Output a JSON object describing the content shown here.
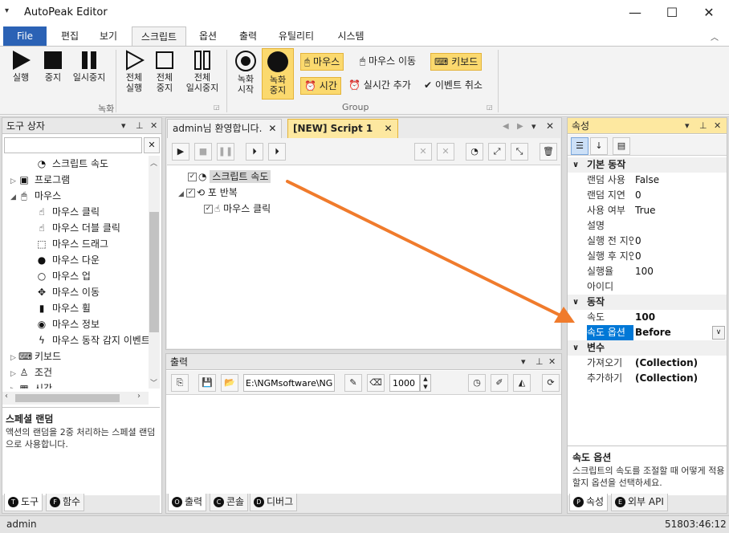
{
  "window": {
    "title": "AutoPeak Editor",
    "menu_glyph": "▾",
    "minimize": "—",
    "maximize": "☐",
    "close": "✕"
  },
  "ribbon_tabs": {
    "file": "File",
    "tabs": [
      "편집",
      "보기",
      "스크립트",
      "옵션",
      "출력",
      "유틸리티",
      "시스템"
    ],
    "active": "스크립트"
  },
  "ribbon": {
    "run": "실행",
    "stop": "중지",
    "pause": "일시중지",
    "run_all_1": "전체",
    "run_all_2": "실행",
    "stop_all_1": "전체",
    "stop_all_2": "중지",
    "pause_all_1": "전체",
    "pause_all_2": "일시중지",
    "rec_start_1": "녹화",
    "rec_start_2": "시작",
    "rec_stop_1": "녹화",
    "rec_stop_2": "중지",
    "group_record": "녹화",
    "group_group": "Group",
    "mouse": "마우스",
    "mouse_move": "마우스 이동",
    "keyboard": "키보드",
    "time": "시간",
    "realtime_add": "실시간 추가",
    "event_cancel": "이벤트 취소"
  },
  "toolbox": {
    "title": "도구 상자",
    "search_value": "",
    "items": [
      {
        "label": "스크립트 속도",
        "icon": "gauge-icon"
      },
      {
        "label": "프로그램",
        "icon": "program-icon"
      },
      {
        "label": "마우스",
        "icon": "mouse-icon"
      },
      {
        "label": "마우스 클릭",
        "icon": "mouse-click-icon"
      },
      {
        "label": "마우스 더블 클릭",
        "icon": "mouse-double-click-icon"
      },
      {
        "label": "마우스 드래그",
        "icon": "mouse-drag-icon"
      },
      {
        "label": "마우스 다운",
        "icon": "mouse-down-icon"
      },
      {
        "label": "마우스 업",
        "icon": "mouse-up-icon"
      },
      {
        "label": "마우스 이동",
        "icon": "mouse-move-icon"
      },
      {
        "label": "마우스 휠",
        "icon": "mouse-wheel-icon"
      },
      {
        "label": "마우스 정보",
        "icon": "mouse-info-icon"
      },
      {
        "label": "마우스 동작 감지 이벤트",
        "icon": "lightning-icon"
      },
      {
        "label": "키보드",
        "icon": "keyboard-icon"
      },
      {
        "label": "조건",
        "icon": "condition-icon"
      },
      {
        "label": "시간",
        "icon": "calendar-icon"
      }
    ],
    "desc_title": "스페셜 랜덤",
    "desc_text": "액션의 랜덤을 2중 처리하는 스페셜 랜덤으로 사용합니다.",
    "tab_tools": "도구",
    "tab_functions": "함수"
  },
  "editor": {
    "tab1": "admin님 환영합니다.",
    "tab2": "[NEW] Script 1",
    "tree": [
      {
        "label": "스크립트 속도"
      },
      {
        "label": "포 반복"
      },
      {
        "label": "마우스 클릭"
      }
    ]
  },
  "output": {
    "title": "출력",
    "path_value": "E:\\NGMsoftware\\NG",
    "number_value": "1000",
    "tab_output": "출력",
    "tab_console": "콘솔",
    "tab_debug": "디버그"
  },
  "properties": {
    "title": "속성",
    "categories": [
      {
        "name": "기본 동작",
        "rows": [
          {
            "name": "랜덤 사용",
            "value": "False"
          },
          {
            "name": "랜덤 지연",
            "value": "0"
          },
          {
            "name": "사용 여부",
            "value": "True"
          },
          {
            "name": "설명",
            "value": ""
          },
          {
            "name": "실행 전 지연",
            "value": "0"
          },
          {
            "name": "실행 후 지연",
            "value": "0"
          },
          {
            "name": "실행율",
            "value": "100"
          },
          {
            "name": "아이디",
            "value": ""
          }
        ]
      },
      {
        "name": "동작",
        "rows": [
          {
            "name": "속도",
            "value": "100"
          },
          {
            "name": "속도 옵션",
            "value": "Before"
          }
        ]
      },
      {
        "name": "변수",
        "rows": [
          {
            "name": "가져오기",
            "value": "(Collection)"
          },
          {
            "name": "추가하기",
            "value": "(Collection)"
          }
        ]
      }
    ],
    "desc_title": "속도 옵션",
    "desc_text": "스크립트의 속도를 조절할 때 어떻게 적용할지 옵션을 선택하세요.",
    "tab_props": "속성",
    "tab_api": "외부 API"
  },
  "status": {
    "user": "admin",
    "time": "51803:46:12"
  },
  "colors": {
    "accent": "#2b62b5",
    "highlight": "#fbd96e",
    "arrow": "#f07b2c",
    "selection": "#0078d7"
  }
}
